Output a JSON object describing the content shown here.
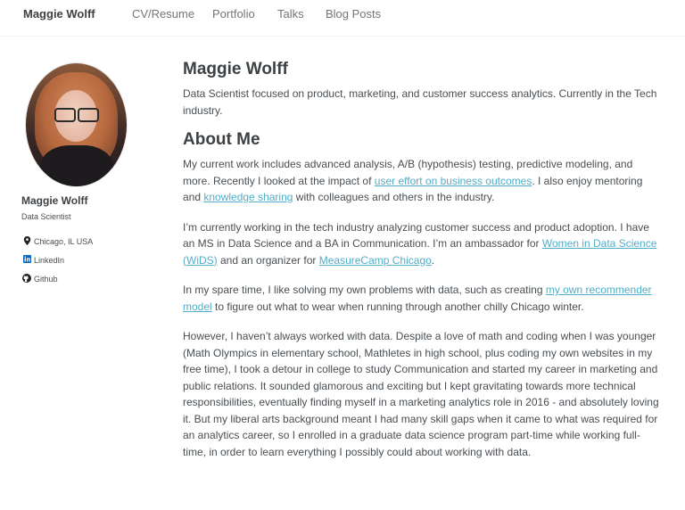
{
  "masthead": {
    "site_title": "Maggie Wolff",
    "nav": [
      "CV/Resume",
      "Portfolio",
      "Talks",
      "Blog Posts"
    ]
  },
  "sidebar": {
    "name": "Maggie Wolff",
    "bio": "Data Scientist",
    "links": [
      {
        "icon": "location-pin-icon",
        "label": "Chicago, IL USA"
      },
      {
        "icon": "linkedin-icon",
        "label": "LinkedIn"
      },
      {
        "icon": "github-icon",
        "label": "Github"
      }
    ]
  },
  "main": {
    "title": "Maggie Wolff",
    "lead": "Data Scientist focused on product, marketing, and customer success analytics. Currently in the Tech industry.",
    "about_heading": "About Me",
    "p1": {
      "a": "My current work includes advanced analysis, A/B (hypothesis) testing, predictive modeling, and more. Recently I looked at the impact of ",
      "link1": "user effort on business outcomes",
      "b": ". I also enjoy mentoring and ",
      "link2": "knowledge sharing",
      "c": " with colleagues and others in the industry."
    },
    "p2": {
      "a": "I’m currently working in the tech industry analyzing customer success and product adoption. I have an MS in Data Science and a BA in Communication. I’m an ambassador for ",
      "link1": "Women in Data Science (WiDS)",
      "b": " and an organizer for ",
      "link2": "MeasureCamp Chicago",
      "c": "."
    },
    "p3": {
      "a": "In my spare time, I like solving my own problems with data, such as creating ",
      "link1": "my own recommender model",
      "b": " to figure out what to wear when running through another chilly Chicago winter."
    },
    "p4": "However, I haven’t always worked with data. Despite a love of math and coding when I was younger (Math Olympics in elementary school, Mathletes in high school, plus coding my own websites in my free time), I took a detour in college to study Communication and started my career in marketing and public relations. It sounded glamorous and exciting but I kept gravitating towards more technical responsibilities, eventually finding myself in a marketing analytics role in 2016 - and absolutely loving it. But my liberal arts background meant I had many skill gaps when it came to what was required for an analytics career, so I enrolled in a graduate data science program part-time while working full-time, in order to learn everything I possibly could about working with data."
  },
  "colors": {
    "link": "#52adc8",
    "text": "#494e52",
    "heading": "#3d4144",
    "nav": "#6f777d"
  }
}
